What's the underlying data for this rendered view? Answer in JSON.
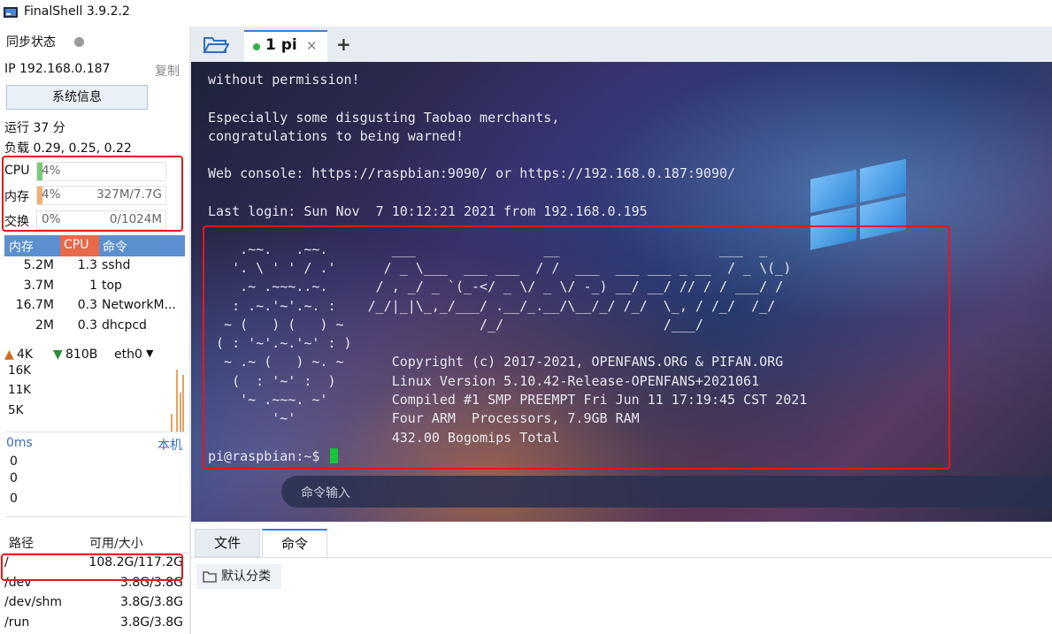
{
  "window": {
    "title": "FinalShell 3.9.2.2"
  },
  "sidebar": {
    "sync_label": "同步状态",
    "ip_label": "IP 192.168.0.187",
    "copy_label": "复制",
    "sysinfo_button": "系统信息",
    "uptime": "运行 37 分",
    "load": "负载 0.29, 0.25, 0.22",
    "cpu": {
      "label": "CPU",
      "value": "4%",
      "fraction": 0.04
    },
    "mem": {
      "label": "内存",
      "value": "4%",
      "detail": "327M/7.7G",
      "fraction": 0.04
    },
    "swap": {
      "label": "交换",
      "value": "0%",
      "detail": "0/1024M",
      "fraction": 0.0
    },
    "process_table": {
      "headers": [
        "内存",
        "CPU",
        "命令"
      ],
      "rows": [
        [
          "5.2M",
          "1.3",
          "sshd"
        ],
        [
          "3.7M",
          "1",
          "top"
        ],
        [
          "16.7M",
          "0.3",
          "NetworkM..."
        ],
        [
          "2M",
          "0.3",
          "dhcpcd"
        ]
      ]
    },
    "network": {
      "upload": "4K",
      "download": "810B",
      "interface": "eth0",
      "y_ticks": [
        "16K",
        "11K",
        "5K"
      ]
    },
    "ping": {
      "latency": "0ms",
      "host": "本机",
      "values": [
        "0",
        "0",
        "0"
      ]
    },
    "fs_table": {
      "headers": [
        "路径",
        "可用/大小"
      ],
      "rows": [
        [
          "/",
          "108.2G/117.2G"
        ],
        [
          "/dev",
          "3.8G/3.8G"
        ],
        [
          "/dev/shm",
          "3.8G/3.8G"
        ],
        [
          "/run",
          "3.8G/3.8G"
        ]
      ]
    }
  },
  "tabs": {
    "session_label": "1 pi",
    "close_glyph": "✕",
    "add_glyph": "+"
  },
  "terminal": {
    "lines": [
      "without permission!",
      "",
      "Especially some disgusting Taobao merchants,",
      "congratulations to being warned!",
      "",
      "Web console: https://raspbian:9090/ or https://192.168.0.187:9090/",
      "",
      "Last login: Sun Nov  7 10:12:21 2021 from 192.168.0.195",
      "",
      "    .~~.   .~~.        ___                __                    ___  _",
      "   '. \\ ' ' / .'      / _ \\___  ___ ___  / /  ___  ___ ___ _ __  / _ \\(_)",
      "    .~ .~~~..~.      / , _/ _ `(_-</ _ \\/ _ \\/ -_) __/ __/ // / / ___/ /",
      "   : .~.'~'.~. :    /_/|_|\\_,_/___/ .__/_.__/\\__/_/ /_/  \\_, / /_/  /_/",
      "  ~ (   ) (   ) ~                 /_/                    /___/",
      " ( : '~'.~.'~' : )",
      "  ~ .~ (   ) ~. ~      Copyright (c) 2017-2021, OPENFANS.ORG & PIFAN.ORG",
      "   (  : '~' :  )       Linux Version 5.10.42-Release-OPENFANS+2021061",
      "    '~ .~~~. ~'        Compiled #1 SMP PREEMPT Fri Jun 11 17:19:45 CST 2021",
      "        '~'            Four ARM  Processors, 7.9GB RAM",
      "                       432.00 Bogomips Total"
    ],
    "prompt": "pi@raspbian:~$",
    "command_placeholder": "命令输入"
  },
  "bottom_panel": {
    "tab_files": "文件",
    "tab_commands": "命令",
    "default_group": "默认分类"
  },
  "colors": {
    "accent": "#3b7ddd",
    "table_header": "#5b8fcf",
    "cpu_header": "#e8694a",
    "highlight_box": "#e8161c",
    "cursor": "#18c43b",
    "upload_arrow": "#d2691e",
    "download_arrow": "#2e8b3a"
  }
}
